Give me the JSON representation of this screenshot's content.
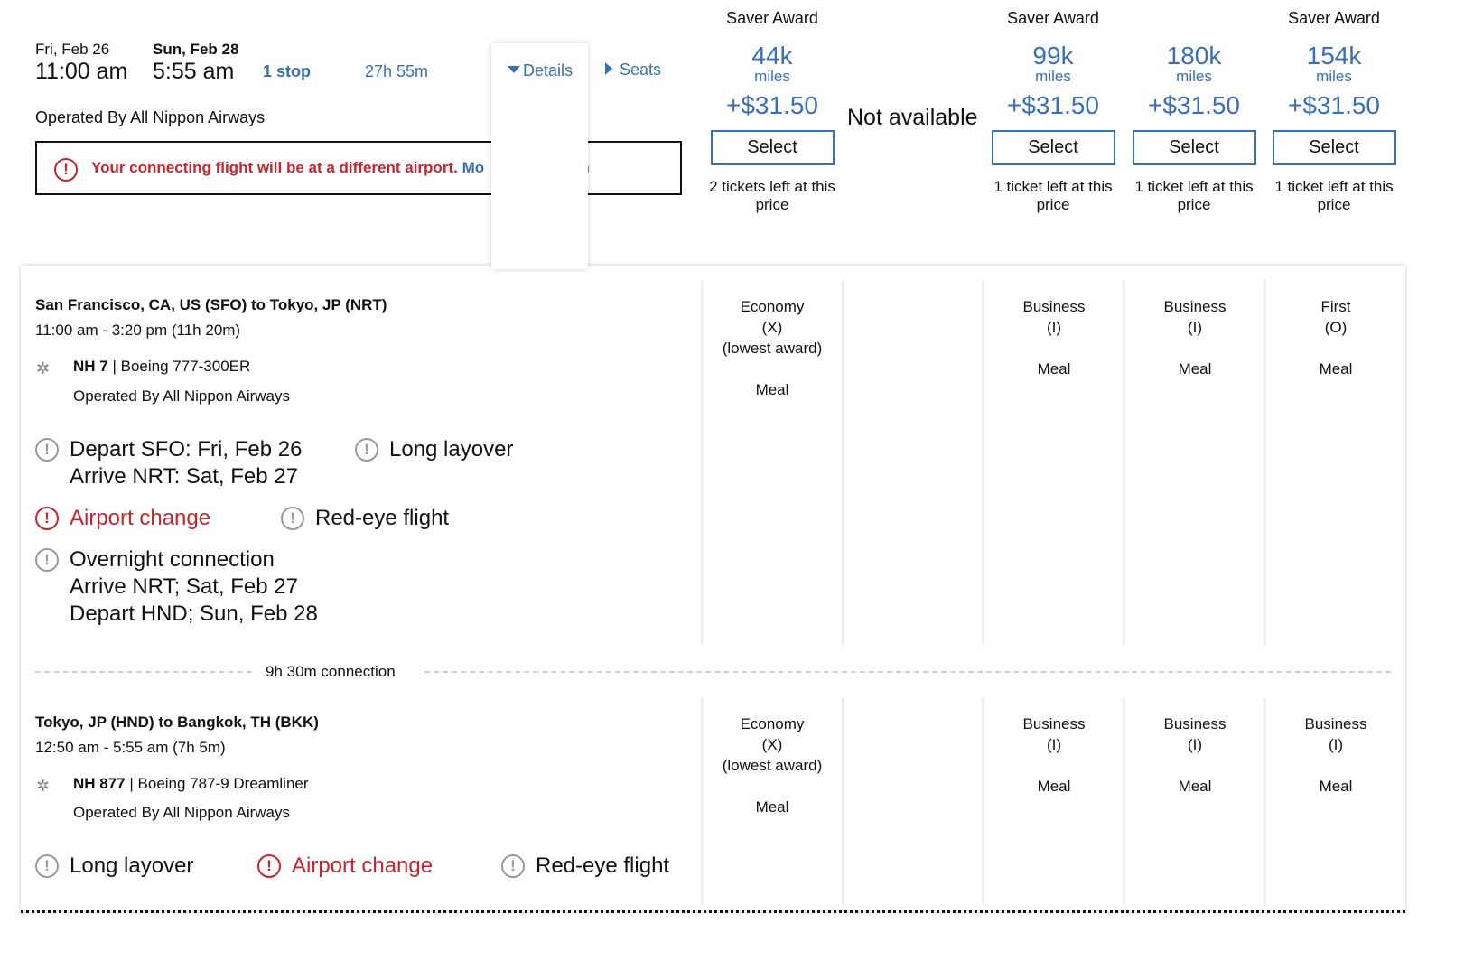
{
  "summary": {
    "depart_date": "Fri, Feb 26",
    "depart_time": "11:00 am",
    "arrive_date": "Sun, Feb 28",
    "arrive_time": "5:55 am",
    "stops": "1 stop",
    "duration": "27h 55m",
    "details_label": "Details",
    "seats_label": "Seats",
    "operated_by": "Operated By All Nippon Airways",
    "warning_text": "Your connecting flight will be at a different airport.",
    "warning_link_left": "Mo",
    "warning_link_right": "on"
  },
  "fares": [
    {
      "label": "Saver Award",
      "miles": "44k",
      "miles_unit": "miles",
      "tax": "+$31.50",
      "select": "Select",
      "left_line1": "2 tickets left at this",
      "left_line2": "price"
    },
    {
      "not_available": "Not available"
    },
    {
      "label": "Saver Award",
      "miles": "99k",
      "miles_unit": "miles",
      "tax": "+$31.50",
      "select": "Select",
      "left_line1": "1 ticket left at this",
      "left_line2": "price"
    },
    {
      "label": "",
      "miles": "180k",
      "miles_unit": "miles",
      "tax": "+$31.50",
      "select": "Select",
      "left_line1": "1 ticket left at this",
      "left_line2": "price"
    },
    {
      "label": "Saver Award",
      "miles": "154k",
      "miles_unit": "miles",
      "tax": "+$31.50",
      "select": "Select",
      "left_line1": "1 ticket left at this",
      "left_line2": "price"
    }
  ],
  "segments": [
    {
      "title": "San Francisco, CA, US (SFO) to Tokyo, JP (NRT)",
      "time": "11:00 am - 3:20 pm (11h 20m)",
      "flight_no": "NH 7",
      "aircraft": "Boeing 777-300ER",
      "operated_by": "Operated By All Nippon Airways",
      "cabins": [
        {
          "cabin": "Economy",
          "code": "(X)",
          "note": "(lowest award)",
          "meal": "Meal"
        },
        {
          "cabin": "",
          "code": "",
          "note": "",
          "meal": ""
        },
        {
          "cabin": "Business",
          "code": "(I)",
          "note": "",
          "meal": "Meal"
        },
        {
          "cabin": "Business",
          "code": "(I)",
          "note": "",
          "meal": "Meal"
        },
        {
          "cabin": "First",
          "code": "(O)",
          "note": "",
          "meal": "Meal"
        }
      ],
      "alerts": {
        "depart": "Depart SFO: Fri, Feb 26",
        "arrive": "Arrive NRT: Sat, Feb 27",
        "long_layover": "Long layover",
        "airport_change": "Airport change",
        "red_eye": "Red-eye flight",
        "overnight": "Overnight connection",
        "overnight_arrive": "Arrive NRT; Sat, Feb 27",
        "overnight_depart": "Depart HND; Sun, Feb 28"
      }
    },
    {
      "title": "Tokyo, JP (HND) to Bangkok, TH (BKK)",
      "time": "12:50 am - 5:55 am (7h 5m)",
      "flight_no": "NH 877",
      "aircraft": "Boeing 787-9 Dreamliner",
      "operated_by": "Operated By All Nippon Airways",
      "cabins": [
        {
          "cabin": "Economy",
          "code": "(X)",
          "note": "(lowest award)",
          "meal": "Meal"
        },
        {
          "cabin": "",
          "code": "",
          "note": "",
          "meal": ""
        },
        {
          "cabin": "Business",
          "code": "(I)",
          "note": "",
          "meal": "Meal"
        },
        {
          "cabin": "Business",
          "code": "(I)",
          "note": "",
          "meal": "Meal"
        },
        {
          "cabin": "Business",
          "code": "(I)",
          "note": "",
          "meal": "Meal"
        }
      ],
      "alerts": {
        "long_layover": "Long layover",
        "airport_change": "Airport change",
        "red_eye": "Red-eye flight"
      }
    }
  ],
  "connection": "9h 30m connection",
  "icons": {
    "alert": "!",
    "airline": "✲",
    "separator": "|"
  },
  "colors": {
    "accent": "#3a6fb5",
    "alert_red": "#c4262e",
    "alert_grey": "#9a9a9a"
  }
}
